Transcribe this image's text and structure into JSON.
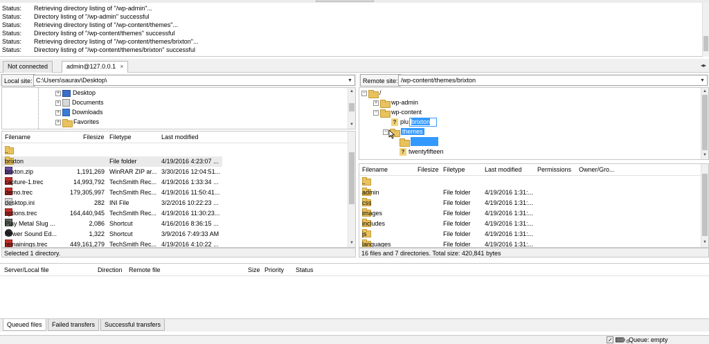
{
  "log": {
    "label": "Status:",
    "messages": [
      "Retrieving directory listing of \"/wp-admin\"...",
      "Directory listing of \"/wp-admin\" successful",
      "Retrieving directory listing of \"/wp-content/themes\"...",
      "Directory listing of \"/wp-content/themes\" successful",
      "Retrieving directory listing of \"/wp-content/themes/brixton\"...",
      "Directory listing of \"/wp-content/themes/brixton\" successful"
    ]
  },
  "tabs": [
    {
      "label": "Not connected"
    },
    {
      "label": "admin@127.0.0.1",
      "close": "×"
    }
  ],
  "local": {
    "site_label": "Local site:",
    "path": "C:\\Users\\saurav\\Desktop\\",
    "tree": [
      "Desktop",
      "Documents",
      "Downloads",
      "Favorites"
    ],
    "columns": [
      "Filename",
      "Filesize",
      "Filetype",
      "Last modified"
    ],
    "files": [
      {
        "name": "..",
        "size": "",
        "type": "",
        "modified": ""
      },
      {
        "name": "brixton",
        "size": "",
        "type": "File folder",
        "modified": "4/19/2016 4:23:07 ..."
      },
      {
        "name": "brixton.zip",
        "size": "1,191,269",
        "type": "WinRAR ZIP ar...",
        "modified": "3/30/2016 12:04:51..."
      },
      {
        "name": "capture-1.trec",
        "size": "14,993,792",
        "type": "TechSmith Rec...",
        "modified": "4/19/2016 1:33:34 ..."
      },
      {
        "name": "demo.trec",
        "size": "179,305,997",
        "type": "TechSmith Rec...",
        "modified": "4/19/2016 11:50:41..."
      },
      {
        "name": "desktop.ini",
        "size": "282",
        "type": "INI File",
        "modified": "3/2/2016 10:22:23 ..."
      },
      {
        "name": "options.trec",
        "size": "164,440,945",
        "type": "TechSmith Rec...",
        "modified": "4/19/2016 11:30:23..."
      },
      {
        "name": "Play Metal Slug ...",
        "size": "2,086",
        "type": "Shortcut",
        "modified": "4/16/2016 8:36:15 ..."
      },
      {
        "name": "Power Sound Ed...",
        "size": "1,322",
        "type": "Shortcut",
        "modified": "3/9/2016 7:49:33 AM"
      },
      {
        "name": "remainings.trec",
        "size": "449,161,279",
        "type": "TechSmith Rec...",
        "modified": "4/19/2016 4:10:22 ..."
      }
    ],
    "status": "Selected 1 directory."
  },
  "remote": {
    "site_label": "Remote site:",
    "path": "/wp-content/themes/brixton",
    "tree": {
      "root": "/",
      "wp_admin": "wp-admin",
      "wp_content": "wp-content",
      "plugins_partial": "plu",
      "edit_text": "brixton",
      "themes": "themes",
      "twentyfifteen": "twentyfifteen"
    },
    "columns": [
      "Filename",
      "Filesize",
      "Filetype",
      "Last modified",
      "Permissions",
      "Owner/Gro..."
    ],
    "files": [
      {
        "name": "..",
        "type": "",
        "modified": ""
      },
      {
        "name": "admin",
        "type": "File folder",
        "modified": "4/19/2016 1:31:..."
      },
      {
        "name": "css",
        "type": "File folder",
        "modified": "4/19/2016 1:31:..."
      },
      {
        "name": "images",
        "type": "File folder",
        "modified": "4/19/2016 1:31:..."
      },
      {
        "name": "includes",
        "type": "File folder",
        "modified": "4/19/2016 1:31:..."
      },
      {
        "name": "js",
        "type": "File folder",
        "modified": "4/19/2016 1:31:..."
      },
      {
        "name": "languages",
        "type": "File folder",
        "modified": "4/19/2016 1:31:..."
      }
    ],
    "status": "16 files and 7 directories. Total size: 420,841 bytes"
  },
  "queue": {
    "columns": [
      "Server/Local file",
      "Direction",
      "Remote file",
      "Size",
      "Priority",
      "Status"
    ],
    "tabs": [
      "Queued files",
      "Failed transfers",
      "Successful transfers"
    ]
  },
  "statusbar": {
    "queue": "Queue: empty"
  }
}
